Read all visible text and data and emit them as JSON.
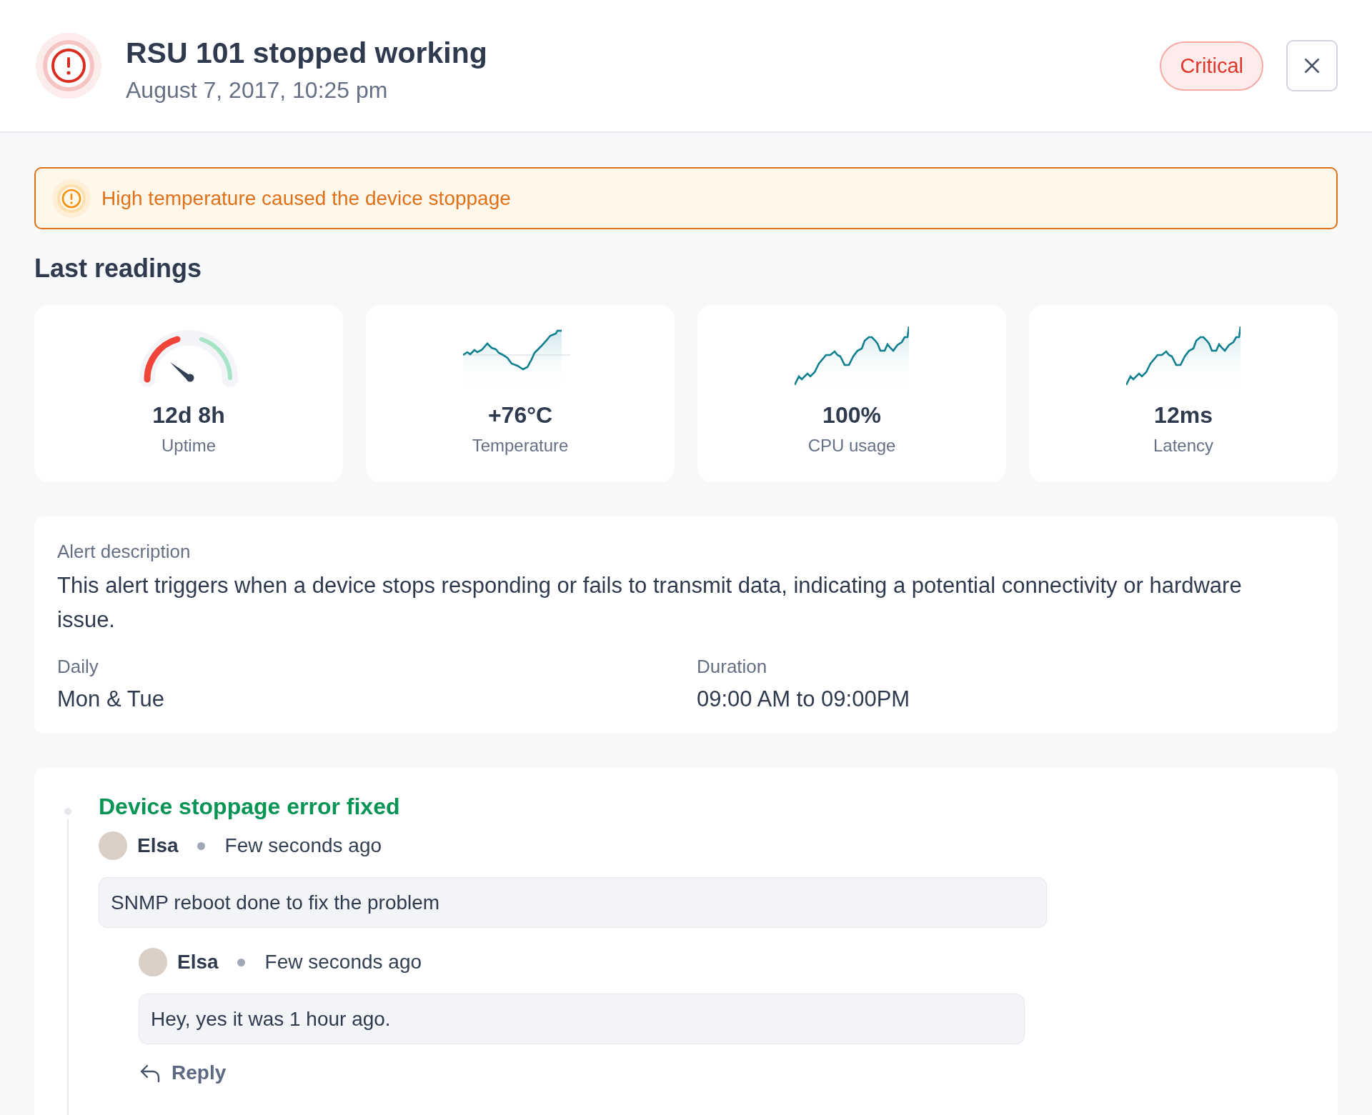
{
  "header": {
    "title": "RSU 101 stopped working",
    "timestamp": "August 7, 2017, 10:25 pm",
    "severity": "Critical"
  },
  "banner": {
    "message": "High temperature caused the device stoppage"
  },
  "readings": {
    "title": "Last readings",
    "items": [
      {
        "kind": "gauge",
        "value": "12d 8h",
        "label": "Uptime"
      },
      {
        "kind": "sparkline",
        "value": "+76°C",
        "label": "Temperature"
      },
      {
        "kind": "sparkline",
        "value": "100%",
        "label": "CPU usage"
      },
      {
        "kind": "sparkline",
        "value": "12ms",
        "label": "Latency"
      }
    ]
  },
  "description": {
    "label": "Alert description",
    "text": "This alert triggers when a device stops responding or fails to transmit data, indicating a potential connectivity or hardware issue.",
    "fields": [
      {
        "label": "Daily",
        "value": "Mon & Tue"
      },
      {
        "label": "Duration",
        "value": "09:00 AM to 09:00PM"
      }
    ]
  },
  "activity": {
    "title": "Device stoppage error fixed",
    "comments": [
      {
        "author": "Elsa",
        "time": "Few seconds ago",
        "text": "SNMP reboot done to fix the problem",
        "replies": [
          {
            "author": "Elsa",
            "time": "Few seconds ago",
            "text": "Hey, yes it was 1 hour ago."
          }
        ]
      }
    ],
    "reply_label": "Reply"
  }
}
